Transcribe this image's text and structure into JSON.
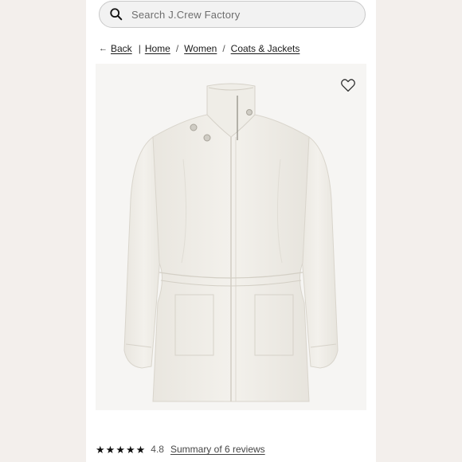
{
  "search": {
    "placeholder": "Search J.Crew Factory",
    "icon": "search-icon"
  },
  "breadcrumb": {
    "back_label": "Back",
    "items": [
      "Home",
      "Women",
      "Coats & Jackets"
    ]
  },
  "product": {
    "image": "white-utility-jacket-image",
    "favorite_icon": "heart-outline-icon"
  },
  "reviews": {
    "stars_filled": 5,
    "rating": "4.8",
    "summary_label": "Summary of 6 reviews"
  },
  "colors": {
    "page_bg": "#ffffff",
    "side_bg": "#f3efec",
    "product_bg": "#f6f5f3",
    "jacket": "#f1efe9"
  }
}
